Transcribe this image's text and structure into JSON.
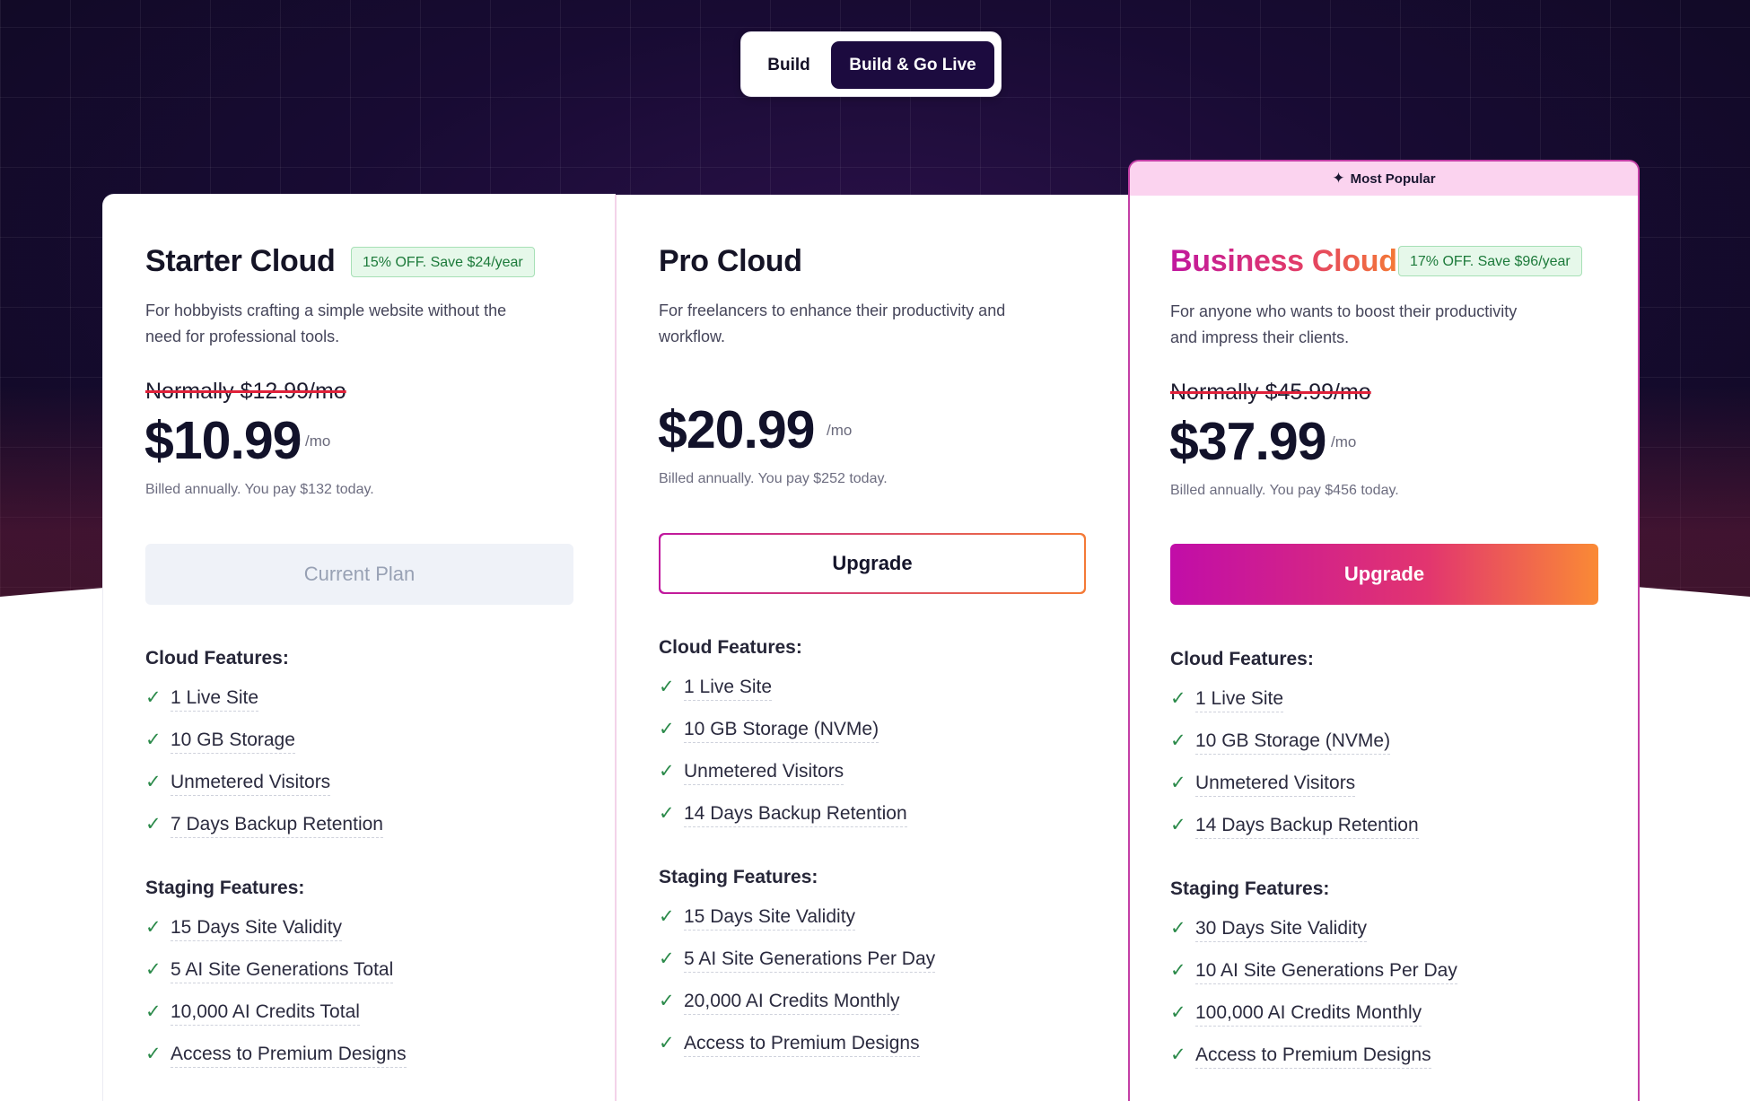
{
  "toggle": {
    "build": "Build",
    "build_go_live": "Build & Go Live"
  },
  "ribbon": {
    "label": "Most Popular"
  },
  "plans": [
    {
      "name": "Starter Cloud",
      "badge": "15% OFF. Save $24/year",
      "desc_1": "For hobbyists crafting a simple website without the",
      "desc_2": "need for professional tools.",
      "normally": "Normally $12.99/mo",
      "price": "$10.99",
      "per": "/mo",
      "billed": "Billed annually. You pay $132 today.",
      "button": "Current Plan",
      "cloud_heading": "Cloud Features:",
      "cloud": [
        "1 Live Site",
        "10 GB Storage",
        "Unmetered Visitors",
        "7 Days Backup Retention"
      ],
      "staging_heading": "Staging Features:",
      "staging": [
        "15 Days Site Validity",
        "5 AI Site Generations Total",
        "10,000 AI Credits Total",
        "Access to Premium Designs"
      ]
    },
    {
      "name": "Pro Cloud",
      "desc_1": "For freelancers to enhance their productivity and",
      "desc_2": "workflow.",
      "price": "$20.99",
      "per": "/mo",
      "billed": "Billed annually. You pay $252 today.",
      "button": "Upgrade",
      "cloud_heading": "Cloud Features:",
      "cloud": [
        "1 Live Site",
        "10 GB Storage (NVMe)",
        "Unmetered Visitors",
        "14 Days Backup Retention"
      ],
      "staging_heading": "Staging Features:",
      "staging": [
        "15 Days Site Validity",
        "5 AI Site Generations Per Day",
        "20,000 AI Credits Monthly",
        "Access to Premium Designs"
      ]
    },
    {
      "name": "Business Cloud",
      "badge": "17% OFF. Save $96/year",
      "desc_1": "For anyone who wants to boost their productivity",
      "desc_2": "and impress their clients.",
      "normally": "Normally $45.99/mo",
      "price": "$37.99",
      "per": "/mo",
      "billed": "Billed annually. You pay $456 today.",
      "button": "Upgrade",
      "cloud_heading": "Cloud Features:",
      "cloud": [
        "1 Live Site",
        "10 GB Storage (NVMe)",
        "Unmetered Visitors",
        "14 Days Backup Retention"
      ],
      "staging_heading": "Staging Features:",
      "staging": [
        "30 Days Site Validity",
        "10 AI Site Generations Per Day",
        "100,000 AI Credits Monthly",
        "Access to Premium Designs"
      ]
    }
  ],
  "colors": {
    "accent_start": "#c10da8",
    "accent_end": "#fa8a35",
    "badge_green": "#1c7a3a",
    "check_green": "#2b8a4a",
    "dark_bg": "#180b33"
  },
  "icons": {
    "check": "check-icon",
    "sparkle": "sparkle-icon"
  }
}
